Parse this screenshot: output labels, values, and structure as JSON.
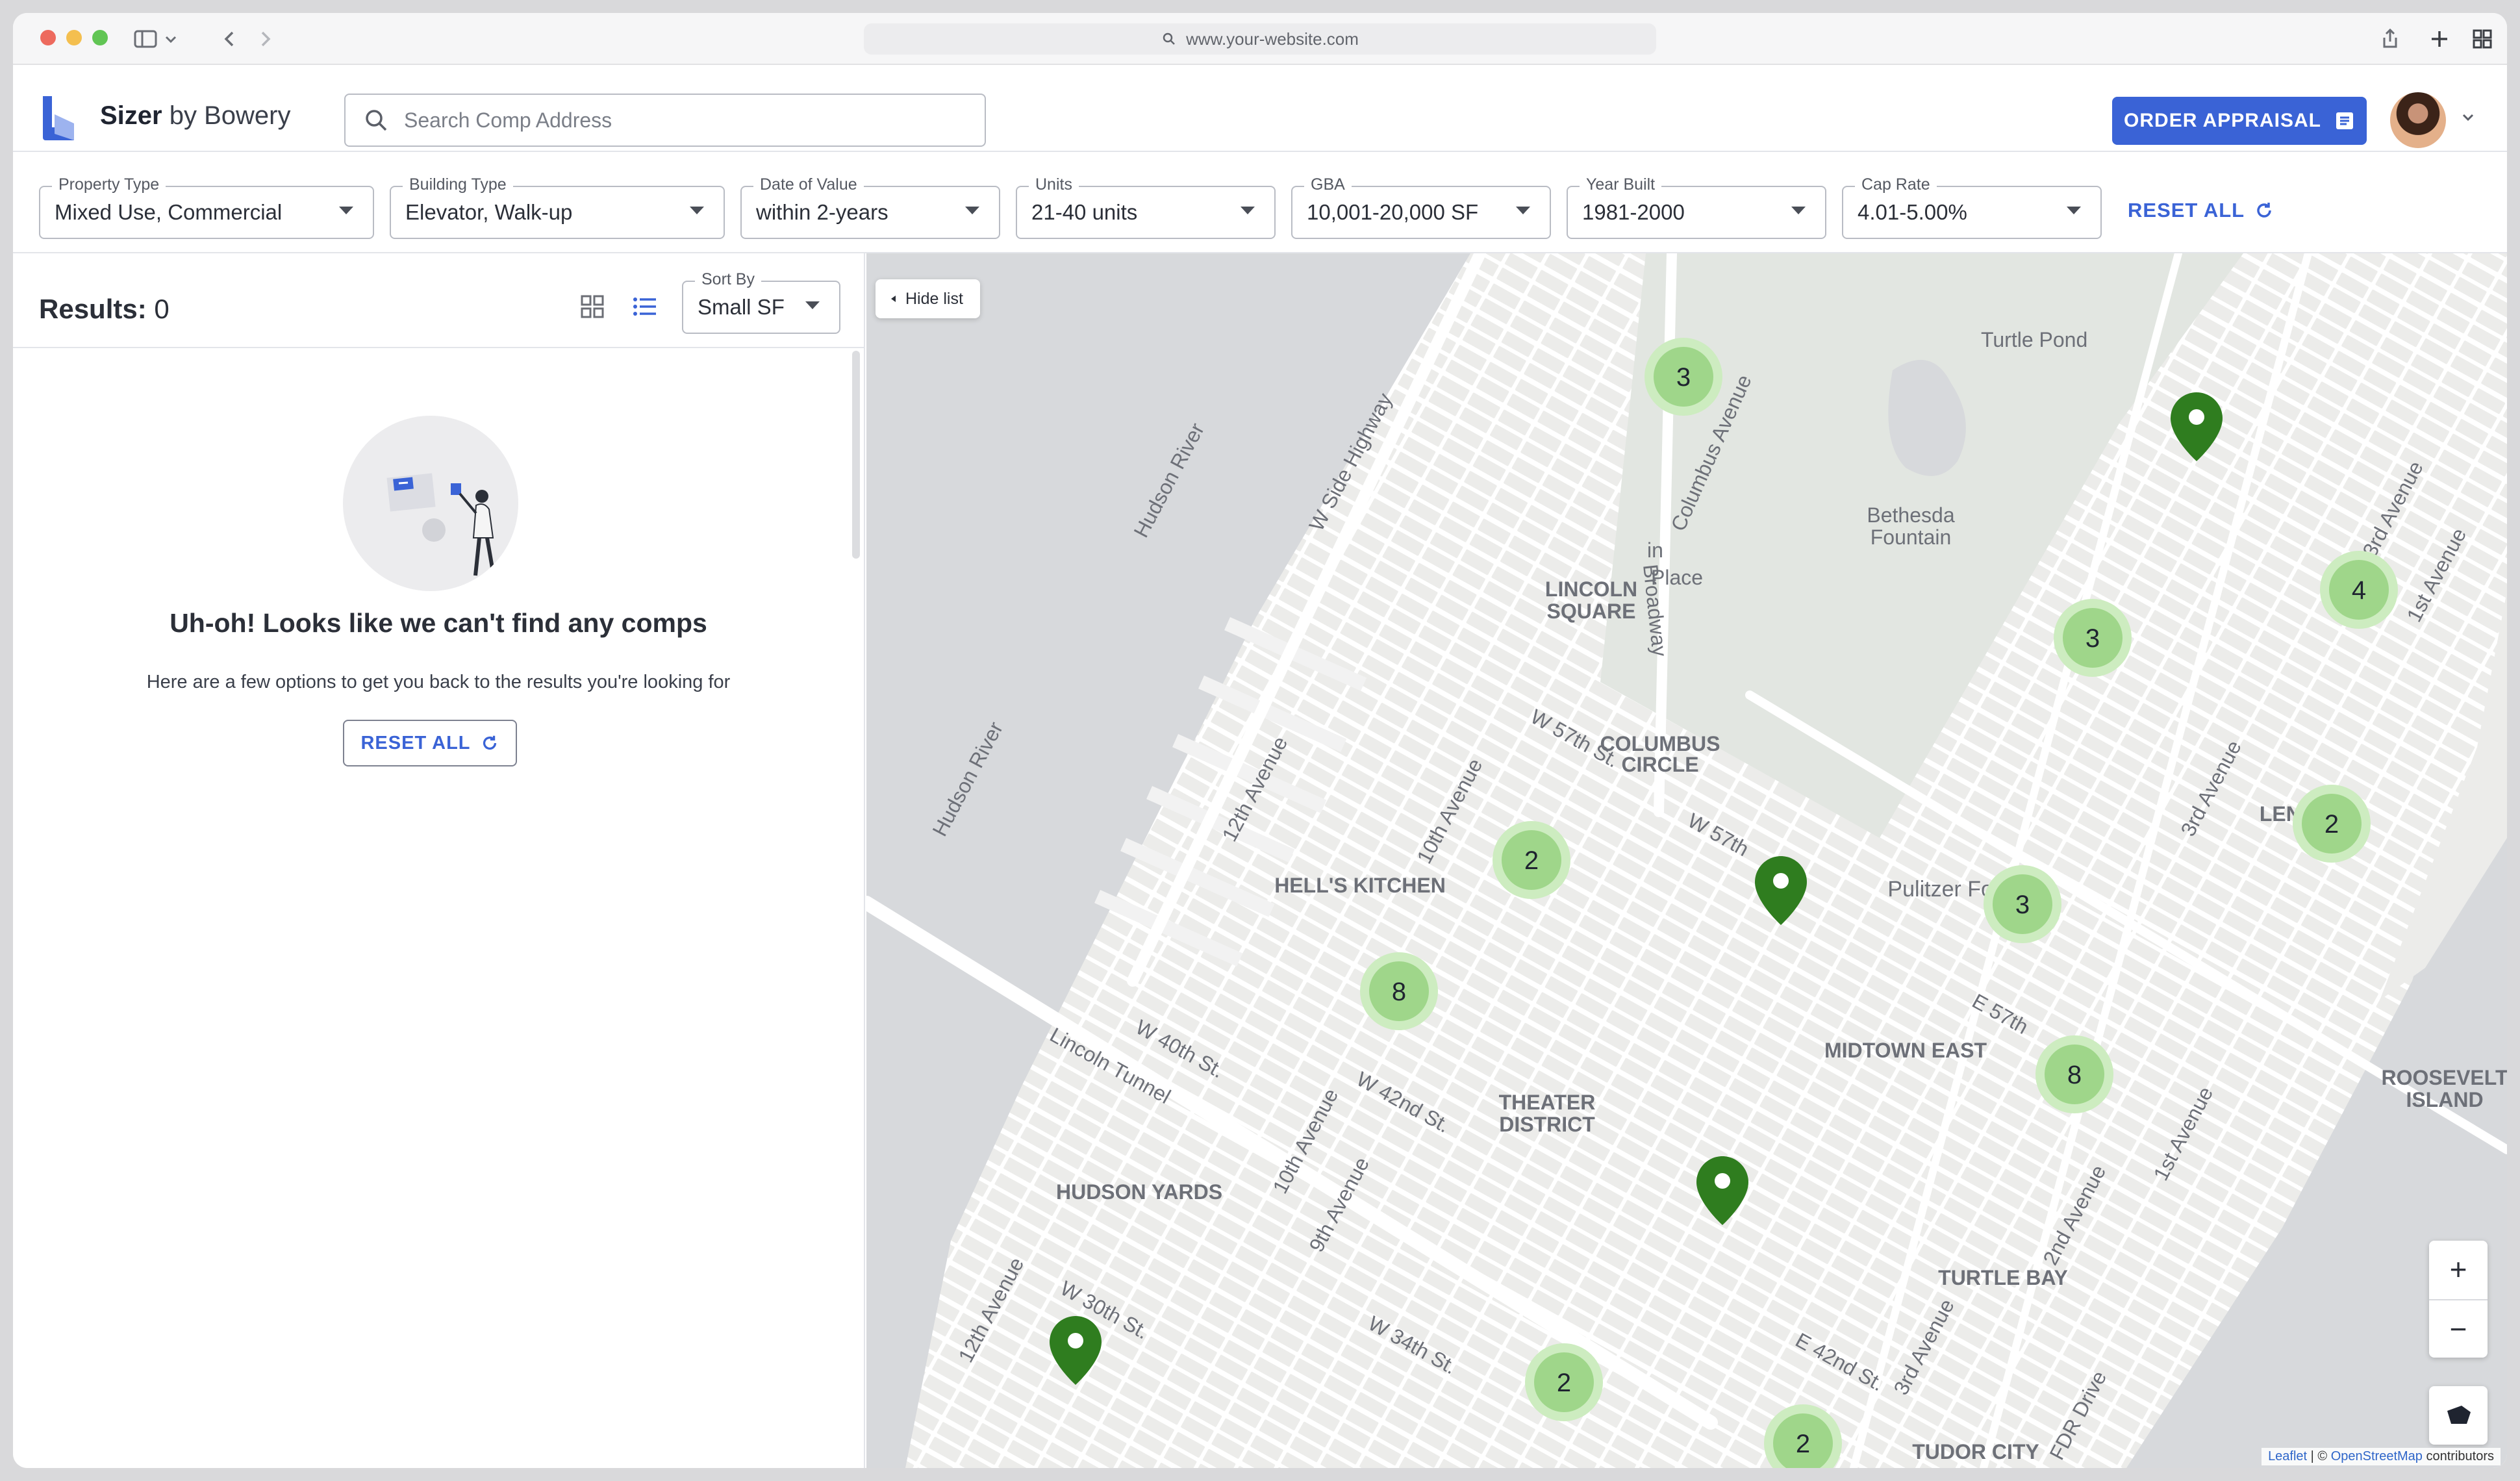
{
  "browser": {
    "url": "www.your-website.com"
  },
  "header": {
    "brand_name": "Sizer",
    "brand_suffix": "by Bowery",
    "search_placeholder": "Search Comp Address",
    "order_button": "ORDER APPRAISAL"
  },
  "filters": {
    "property_type": {
      "label": "Property Type",
      "value": "Mixed Use, Commercial"
    },
    "building_type": {
      "label": "Building Type",
      "value": "Elevator, Walk-up"
    },
    "date_of_value": {
      "label": "Date of Value",
      "value": "within 2-years"
    },
    "units": {
      "label": "Units",
      "value": "21-40 units"
    },
    "gba": {
      "label": "GBA",
      "value": "10,001-20,000 SF"
    },
    "year_built": {
      "label": "Year Built",
      "value": "1981-2000"
    },
    "cap_rate": {
      "label": "Cap Rate",
      "value": "4.01-5.00%"
    },
    "reset_all": "RESET ALL"
  },
  "results": {
    "label": "Results:",
    "count": "0",
    "sort_label": "Sort By",
    "sort_value": "Small SF"
  },
  "empty_state": {
    "title": "Uh-oh! Looks like we can't find any comps",
    "subtitle": "Here are a few options to get you back to the results you're looking for",
    "reset_button": "RESET ALL"
  },
  "map": {
    "hide_list": "Hide list",
    "labels": {
      "turtle_pond": "Turtle Pond",
      "bethesda": "Bethesda",
      "fountain": "Fountain",
      "lincoln": "LINCOLN",
      "square": "SQUARE",
      "columbus": "COLUMBUS",
      "circle": "CIRCLE",
      "hells_kitchen": "HELL'S KITCHEN",
      "pulitzer": "Pulitzer Fountain",
      "midtown_east": "MIDTOWN EAST",
      "theater": "THEATER",
      "district": "DISTRICT",
      "hudson_yards": "HUDSON YARDS",
      "turtle_bay": "TURTLE BAY",
      "tudor_city": "TUDOR CITY",
      "roosevelt": "ROOSEVELT",
      "island": "ISLAND",
      "lenox": "LENOX",
      "hudson_river": "Hudson River",
      "w_side_highway": "W Side Highway",
      "columbus_ave": "Columbus Avenue",
      "broadway": "Broadway",
      "in_place": "in",
      "place": "Place",
      "w57": "W 57th St.",
      "w57b": "W 57th",
      "ave12": "12th Avenue",
      "ave10": "10th Avenue",
      "ave9": "9th Avenue",
      "ave3": "3rd Avenue",
      "ave2": "2nd Avenue",
      "ave1": "1st Avenue",
      "e57": "E 57th",
      "w40": "W 40th St.",
      "lincoln_tunnel": "Lincoln Tunnel",
      "w42": "W 42nd St.",
      "w34": "W 34th St.",
      "w30": "W 30th St.",
      "e42": "E 42nd St.",
      "fdr": "FDR Drive"
    },
    "clusters": [
      "3",
      "3",
      "4",
      "2",
      "2",
      "3",
      "8",
      "8",
      "2",
      "2"
    ],
    "zoom_in": "+",
    "zoom_out": "−",
    "attribution_leaflet": "Leaflet",
    "attribution_sep": " | © ",
    "attribution_osm": "OpenStreetMap",
    "attribution_tail": " contributors"
  },
  "colors": {
    "accent": "#3a63d6",
    "cluster_inner": "#9fd68a",
    "cluster_outer": "#cdecc0",
    "pin": "#2f7d1f",
    "water": "#d7d9dc",
    "park": "#e2e6e1"
  }
}
